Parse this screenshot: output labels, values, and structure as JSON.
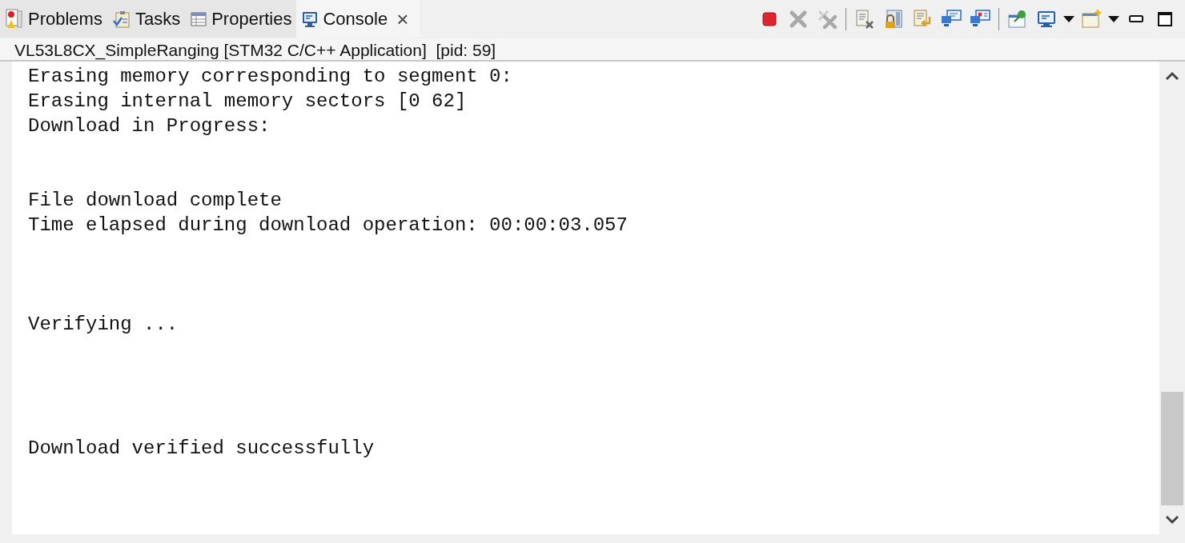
{
  "tabs": [
    {
      "label": "Problems",
      "kind": "problems",
      "selected": false
    },
    {
      "label": "Tasks",
      "kind": "tasks",
      "selected": false
    },
    {
      "label": "Properties",
      "kind": "properties",
      "selected": false
    },
    {
      "label": "Console",
      "kind": "console",
      "selected": true,
      "close": "×"
    }
  ],
  "launch_title": "VL53L8CX_SimpleRanging [STM32 C/C++ Application]  [pid: 59]",
  "console_lines": [
    {
      "kind": "text",
      "text": "Erasing memory corresponding to segment 0:"
    },
    {
      "kind": "text",
      "text": "Erasing internal memory sectors [0 62]"
    },
    {
      "kind": "text",
      "text": "Download in Progress:"
    },
    {
      "kind": "blank"
    },
    {
      "kind": "blank"
    },
    {
      "kind": "text",
      "text": "File download complete"
    },
    {
      "kind": "text",
      "text": "Time elapsed during download operation: 00:00:03.057"
    },
    {
      "kind": "blank"
    },
    {
      "kind": "blank"
    },
    {
      "kind": "blank"
    },
    {
      "kind": "text",
      "text": "Verifying ..."
    },
    {
      "kind": "blank"
    },
    {
      "kind": "blank"
    },
    {
      "kind": "blank"
    },
    {
      "kind": "blank"
    },
    {
      "kind": "text",
      "text": "Download verified successfully"
    }
  ]
}
